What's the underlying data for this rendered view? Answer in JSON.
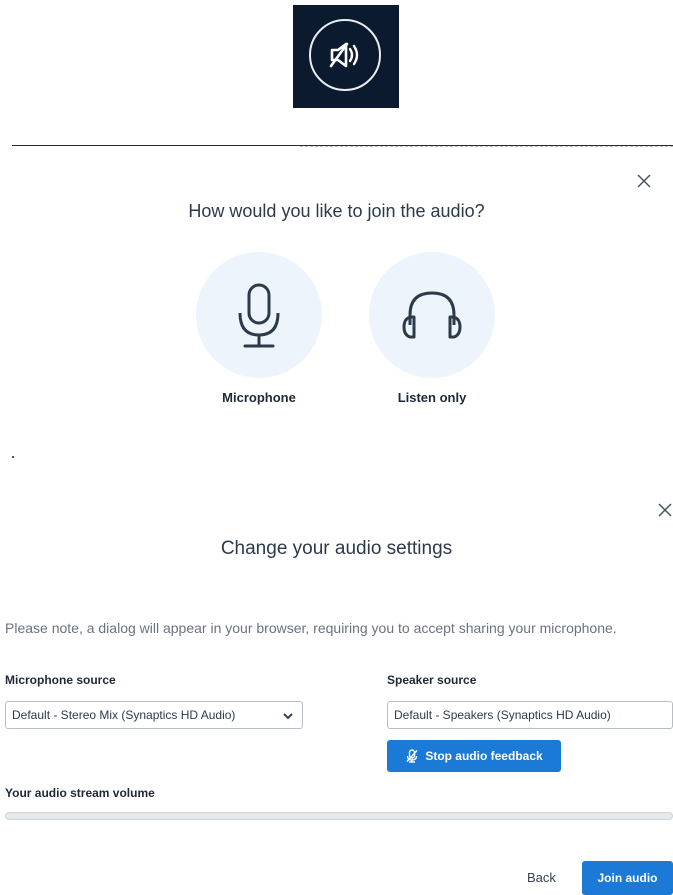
{
  "speaker_tile": {
    "icon": "speaker-muted-icon"
  },
  "dialog_join": {
    "title": "How would you like to join the audio?",
    "options": [
      {
        "label": "Microphone",
        "icon": "microphone-icon"
      },
      {
        "label": "Listen only",
        "icon": "headphones-icon"
      }
    ],
    "close_icon": "close-icon"
  },
  "dialog_settings": {
    "title": "Change your audio settings",
    "note": "Please note, a dialog will appear in your browser, requiring you to accept sharing your microphone.",
    "mic_source_label": "Microphone source",
    "mic_source_value": "Default - Stereo Mix (Synaptics HD Audio)",
    "speaker_source_label": "Speaker source",
    "speaker_source_value": "Default - Speakers (Synaptics HD Audio)",
    "stop_feedback_label": "Stop audio feedback",
    "volume_label": "Your audio stream volume",
    "volume_level": 0,
    "back_label": "Back",
    "join_label": "Join audio",
    "close_icon": "close-icon"
  },
  "colors": {
    "tile_bg": "#0b1a2e",
    "option_bg": "#edf4fc",
    "primary": "#1b7ad6",
    "text": "#2d3a4a",
    "muted_text": "#6b7280"
  }
}
